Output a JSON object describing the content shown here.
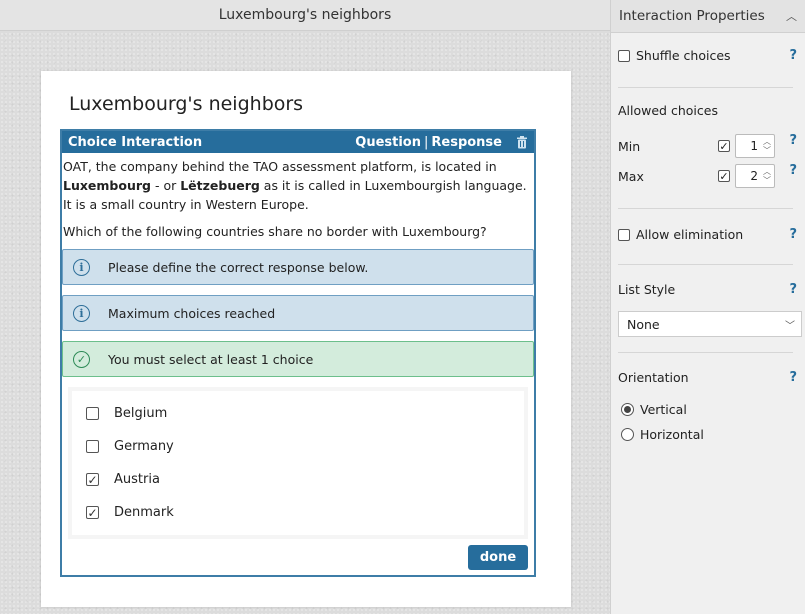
{
  "topbar": {
    "title": "Luxembourg's neighbors"
  },
  "item": {
    "title": "Luxembourg's neighbors",
    "interaction": {
      "label": "Choice Interaction",
      "question_link": "Question",
      "separator": "|",
      "response_link": "Response",
      "prompt": {
        "p1_a": "OAT, the company behind the TAO assessment platform, is located in ",
        "p1_b": "Luxembourg",
        "p1_c": " - or ",
        "p1_d": "Lëtzebuerg",
        "p1_e": " as it is called in Luxembourgish language. It is a small country in Western Europe.",
        "p2": "Which of the following countries share no border with Luxembourg?"
      },
      "feedback": [
        {
          "type": "info",
          "icon": "info-icon",
          "text": "Please define the correct response below."
        },
        {
          "type": "info",
          "icon": "info-icon",
          "text": "Maximum choices reached"
        },
        {
          "type": "success",
          "icon": "check-circle-icon",
          "text": "You must select at least 1 choice"
        }
      ],
      "choices": [
        {
          "label": "Belgium",
          "checked": false
        },
        {
          "label": "Germany",
          "checked": false
        },
        {
          "label": "Austria",
          "checked": true
        },
        {
          "label": "Denmark",
          "checked": true
        }
      ],
      "done_label": "done"
    }
  },
  "panel": {
    "title": "Interaction Properties",
    "shuffle_label": "Shuffle choices",
    "allowed_label": "Allowed choices",
    "min_label": "Min",
    "min_value": "1",
    "max_label": "Max",
    "max_value": "2",
    "allow_elimination_label": "Allow elimination",
    "list_style_label": "List Style",
    "list_style_value": "None",
    "orientation_label": "Orientation",
    "orientation_options": [
      {
        "label": "Vertical",
        "selected": true
      },
      {
        "label": "Horizontal",
        "selected": false
      }
    ],
    "help": "?"
  },
  "colors": {
    "accent": "#266d9c",
    "info_bg": "#cfe0ec",
    "success_bg": "#d3ecdc"
  }
}
